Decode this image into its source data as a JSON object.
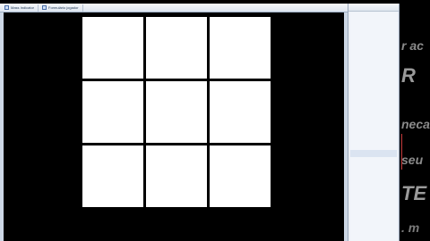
{
  "window": {
    "tabs": [
      {
        "label": "Mass Indicator",
        "icon": "document-icon"
      },
      {
        "label": "Formulário jogador",
        "icon": "document-icon"
      }
    ]
  },
  "board": {
    "cells": [
      "",
      "",
      "",
      "",
      "",
      "",
      "",
      "",
      ""
    ]
  },
  "background_text": {
    "fragments": [
      "",
      "r ac",
      "R",
      "neca",
      "seu",
      "TE",
      ". m"
    ]
  },
  "colors": {
    "board_background": "#000000",
    "cell_fill": "#ffffff",
    "window_chrome": "#dde5ef",
    "side_panel": "#f2f5fa"
  }
}
